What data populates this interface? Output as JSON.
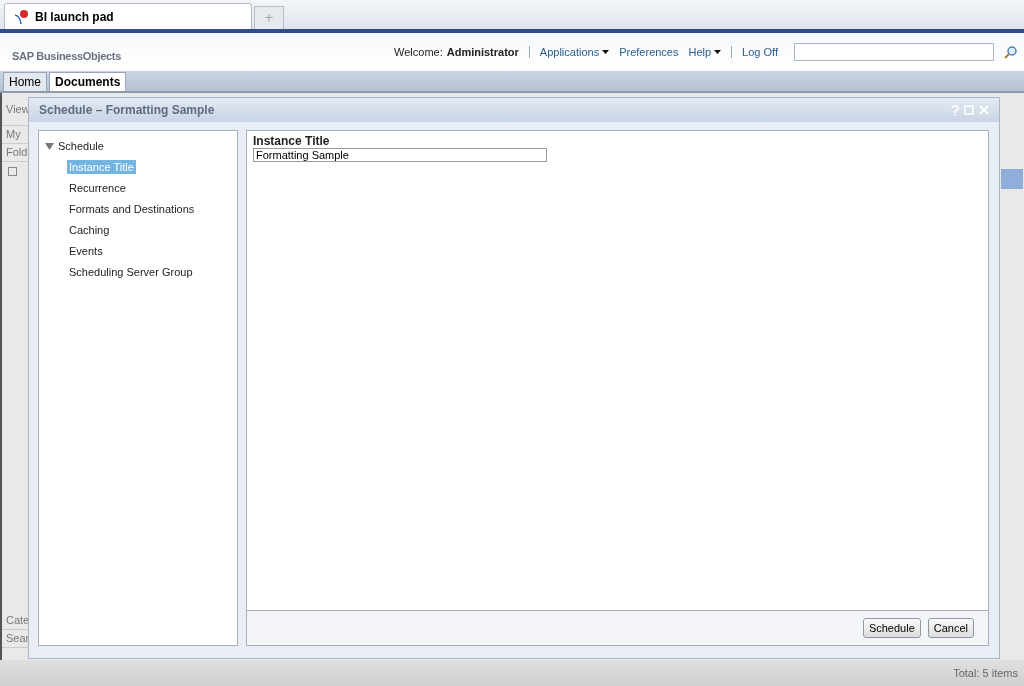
{
  "browser": {
    "tab_title": "BI launch pad",
    "new_tab": "+"
  },
  "header": {
    "logo": "SAP BusinessObjects",
    "welcome_label": "Welcome:",
    "user": "Administrator",
    "links": [
      {
        "label": "Applications",
        "dropdown": true
      },
      {
        "label": "Preferences",
        "dropdown": false
      },
      {
        "label": "Help",
        "dropdown": true
      },
      {
        "label": "Log Off",
        "dropdown": false
      }
    ]
  },
  "tabs": [
    {
      "label": "Home",
      "selected": false
    },
    {
      "label": "Documents",
      "selected": true
    }
  ],
  "background": {
    "toolbar_label": "View",
    "panels": [
      "My",
      "Fold"
    ],
    "bottom_panels": [
      "Cate",
      "Sear"
    ],
    "status": "Total: 5 items"
  },
  "dialog": {
    "title": "Schedule – Formatting Sample",
    "tree": {
      "label": "Schedule",
      "expanded": true,
      "children": [
        {
          "label": "Instance Title",
          "selected": true
        },
        {
          "label": "Recurrence",
          "selected": false
        },
        {
          "label": "Formats and Destinations",
          "selected": false
        },
        {
          "label": "Caching",
          "selected": false
        },
        {
          "label": "Events",
          "selected": false
        },
        {
          "label": "Scheduling Server Group",
          "selected": false
        }
      ]
    },
    "field": {
      "label": "Instance Title",
      "value": "Formatting Sample"
    },
    "buttons": [
      "Schedule",
      "Cancel"
    ]
  }
}
